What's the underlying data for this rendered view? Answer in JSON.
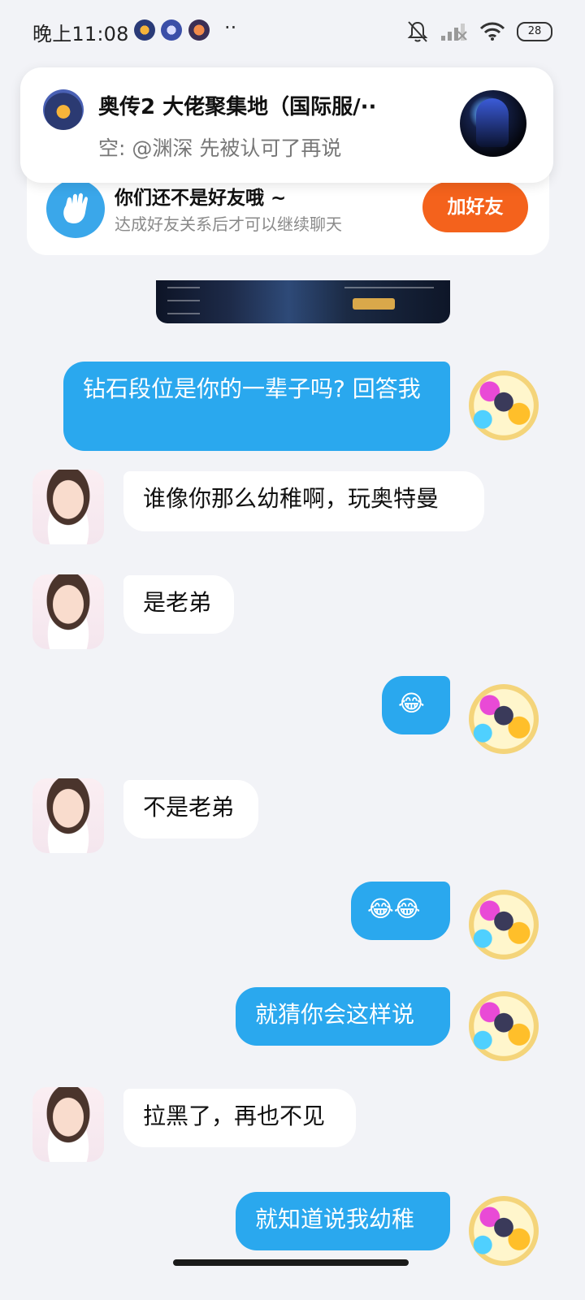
{
  "status_bar": {
    "time": "晚上11:08",
    "app_icons": [
      "game-icon",
      "game-icon",
      "game-icon"
    ],
    "more": "··",
    "battery": "28",
    "icons": [
      "mute-bell-icon",
      "signal-icon",
      "wifi-icon",
      "battery-icon"
    ]
  },
  "notification": {
    "title": "奥传2 大佬聚集地（国际服/··",
    "subtitle": "空: @渊深 先被认可了再说"
  },
  "friend_card": {
    "title": "你们还不是好友哦 ~",
    "subtitle": "达成好友关系后才可以继续聊天",
    "button": "加好友"
  },
  "messages": [
    {
      "side": "out",
      "text": "钻石段位是你的一辈子吗? 回答我"
    },
    {
      "side": "in",
      "text": "谁像你那么幼稚啊，玩奥特曼"
    },
    {
      "side": "in",
      "text": "是老弟"
    },
    {
      "side": "out",
      "text": "😂"
    },
    {
      "side": "in",
      "text": "不是老弟"
    },
    {
      "side": "out",
      "text": "😂😂"
    },
    {
      "side": "out",
      "text": "就猜你会这样说"
    },
    {
      "side": "in",
      "text": "拉黑了，再也不见"
    },
    {
      "side": "out",
      "text": "就知道说我幼稚"
    }
  ],
  "colors": {
    "background": "#f2f3f7",
    "out_bubble": "#2aa8ee",
    "in_bubble": "#ffffff",
    "add_button": "#f4621c"
  }
}
